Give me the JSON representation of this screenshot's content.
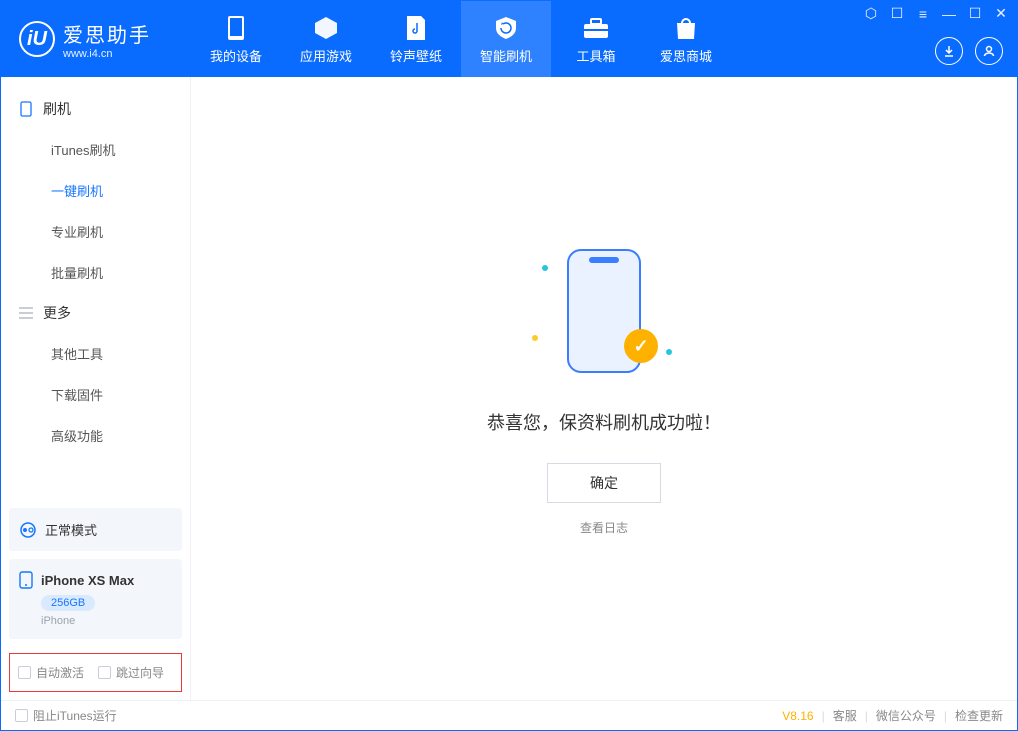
{
  "brand": {
    "name": "爱思助手",
    "url": "www.i4.cn",
    "logo_letter": "iU"
  },
  "nav": {
    "items": [
      {
        "label": "我的设备"
      },
      {
        "label": "应用游戏"
      },
      {
        "label": "铃声壁纸"
      },
      {
        "label": "智能刷机"
      },
      {
        "label": "工具箱"
      },
      {
        "label": "爱思商城"
      }
    ]
  },
  "sidebar": {
    "group_flash": "刷机",
    "flash_items": [
      {
        "label": "iTunes刷机"
      },
      {
        "label": "一键刷机"
      },
      {
        "label": "专业刷机"
      },
      {
        "label": "批量刷机"
      }
    ],
    "group_more": "更多",
    "more_items": [
      {
        "label": "其他工具"
      },
      {
        "label": "下载固件"
      },
      {
        "label": "高级功能"
      }
    ],
    "status_label": "正常模式",
    "device": {
      "name": "iPhone XS Max",
      "storage": "256GB",
      "type": "iPhone"
    },
    "opts": {
      "auto_activate": "自动激活",
      "skip_guide": "跳过向导"
    }
  },
  "main": {
    "success_text": "恭喜您，保资料刷机成功啦！",
    "ok_label": "确定",
    "log_link": "查看日志"
  },
  "footer": {
    "block_itunes": "阻止iTunes运行",
    "version": "V8.16",
    "links": {
      "service": "客服",
      "wechat": "微信公众号",
      "update": "检查更新"
    }
  }
}
